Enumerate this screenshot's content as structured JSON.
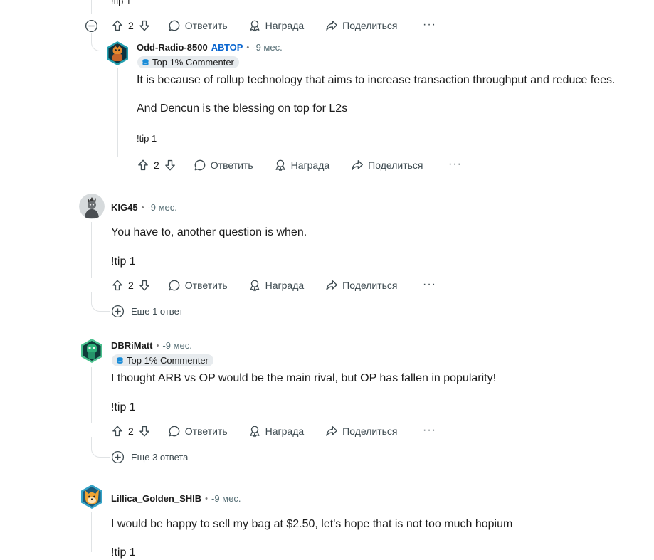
{
  "top_partial": {
    "tip": "!tip 1",
    "votes": "2"
  },
  "labels": {
    "reply": "Ответить",
    "award": "Награда",
    "share": "Поделиться",
    "more": "···",
    "op": "АВТОР",
    "flair": "Top 1% Commenter"
  },
  "comments": [
    {
      "user": "Odd-Radio-8500",
      "time": "-9 мес.",
      "lines": [
        "It is because of rollup technology that aims to increase transaction throughput and reduce fees.",
        "And Dencun is the blessing on top for L2s"
      ],
      "tip": "!tip 1",
      "votes": "2"
    },
    {
      "user": "KIG45",
      "time": "-9 мес.",
      "lines": [
        "You have to, another question is when."
      ],
      "tip": "!tip 1",
      "votes": "2",
      "more_replies": "Еще 1 ответ"
    },
    {
      "user": "DBRiMatt",
      "time": "-9 мес.",
      "lines": [
        "I thought ARB vs OP would be the main rival, but OP has fallen in popularity!"
      ],
      "tip": "!tip 1",
      "votes": "2",
      "more_replies": "Еще 3 ответа"
    },
    {
      "user": "Lillica_Golden_SHIB",
      "time": "-9 мес.",
      "lines": [
        "I would be happy to sell my bag at $2.50, let's hope that is not too much hopium"
      ],
      "tip": "!tip 1"
    }
  ],
  "colors": {
    "op_tag": "#0a66d0",
    "flair_bg": "#e7ebee",
    "thread_line": "#e0e3e5",
    "action_text": "#3d4a50"
  }
}
